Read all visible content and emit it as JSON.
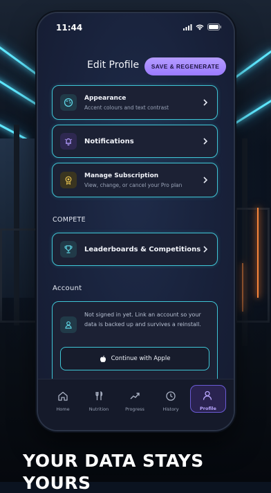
{
  "status_bar": {
    "time": "11:44"
  },
  "header": {
    "title": "Edit Profile",
    "save_label": "SAVE & REGENERATE"
  },
  "settings": [
    {
      "title": "Appearance",
      "subtitle": "Accent colours and text contrast",
      "icon": "palette-icon"
    },
    {
      "title": "Notifications",
      "subtitle": "",
      "icon": "bell-icon"
    },
    {
      "title": "Manage Subscription",
      "subtitle": "View, change, or cancel your Pro plan",
      "icon": "badge-icon"
    }
  ],
  "compete": {
    "heading": "COMPETE",
    "item": {
      "title": "Leaderboards & Competitions",
      "icon": "trophy-icon"
    }
  },
  "account": {
    "heading": "Account",
    "message": "Not signed in yet. Link an account so your data is backed up and survives a reinstall.",
    "apple_button": "Continue with Apple"
  },
  "tabs": [
    {
      "label": "Home",
      "icon": "home-icon"
    },
    {
      "label": "Nutrition",
      "icon": "fork-knife-icon"
    },
    {
      "label": "Progress",
      "icon": "trend-icon"
    },
    {
      "label": "History",
      "icon": "clock-icon"
    },
    {
      "label": "Profile",
      "icon": "person-icon",
      "active": true
    }
  ],
  "promo": {
    "headline": "YOUR DATA STAYS",
    "headline_cont": "YOURS"
  },
  "colors": {
    "accent": "#3fc6d6",
    "primary": "#9b7bff",
    "neon": "#5ee7ff"
  }
}
